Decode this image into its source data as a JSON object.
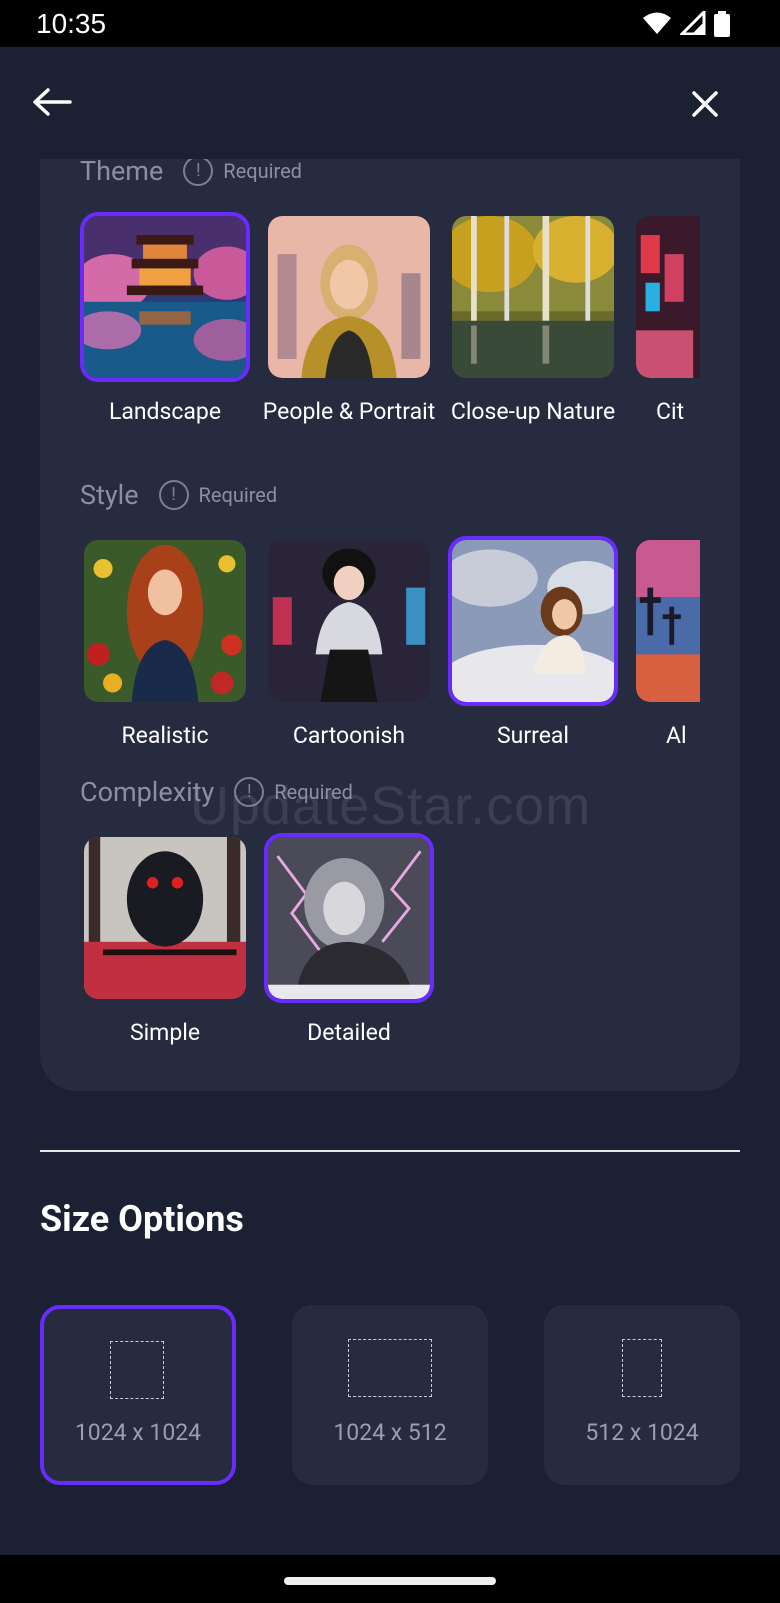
{
  "status_bar": {
    "time": "10:35"
  },
  "theme": {
    "title": "Theme",
    "required_label": "Required",
    "items": [
      {
        "label": "Landscape",
        "selected": true
      },
      {
        "label": "People & Portrait",
        "selected": false
      },
      {
        "label": "Close-up Nature",
        "selected": false
      },
      {
        "label": "Cit",
        "selected": false
      }
    ]
  },
  "style": {
    "title": "Style",
    "required_label": "Required",
    "items": [
      {
        "label": "Realistic",
        "selected": false
      },
      {
        "label": "Cartoonish",
        "selected": false
      },
      {
        "label": "Surreal",
        "selected": true
      },
      {
        "label": "Al",
        "selected": false
      }
    ]
  },
  "complexity": {
    "title": "Complexity",
    "required_label": "Required",
    "items": [
      {
        "label": "Simple",
        "selected": false
      },
      {
        "label": "Detailed",
        "selected": true
      }
    ]
  },
  "watermark": "UpdateStar.com",
  "size_options": {
    "title": "Size Options",
    "items": [
      {
        "label": "1024 x 1024",
        "selected": true
      },
      {
        "label": "1024 x 512",
        "selected": false
      },
      {
        "label": "512 x 1024",
        "selected": false
      }
    ]
  },
  "colors": {
    "background": "#1c2033",
    "panel": "#262b40",
    "accent": "#6a2bff"
  }
}
